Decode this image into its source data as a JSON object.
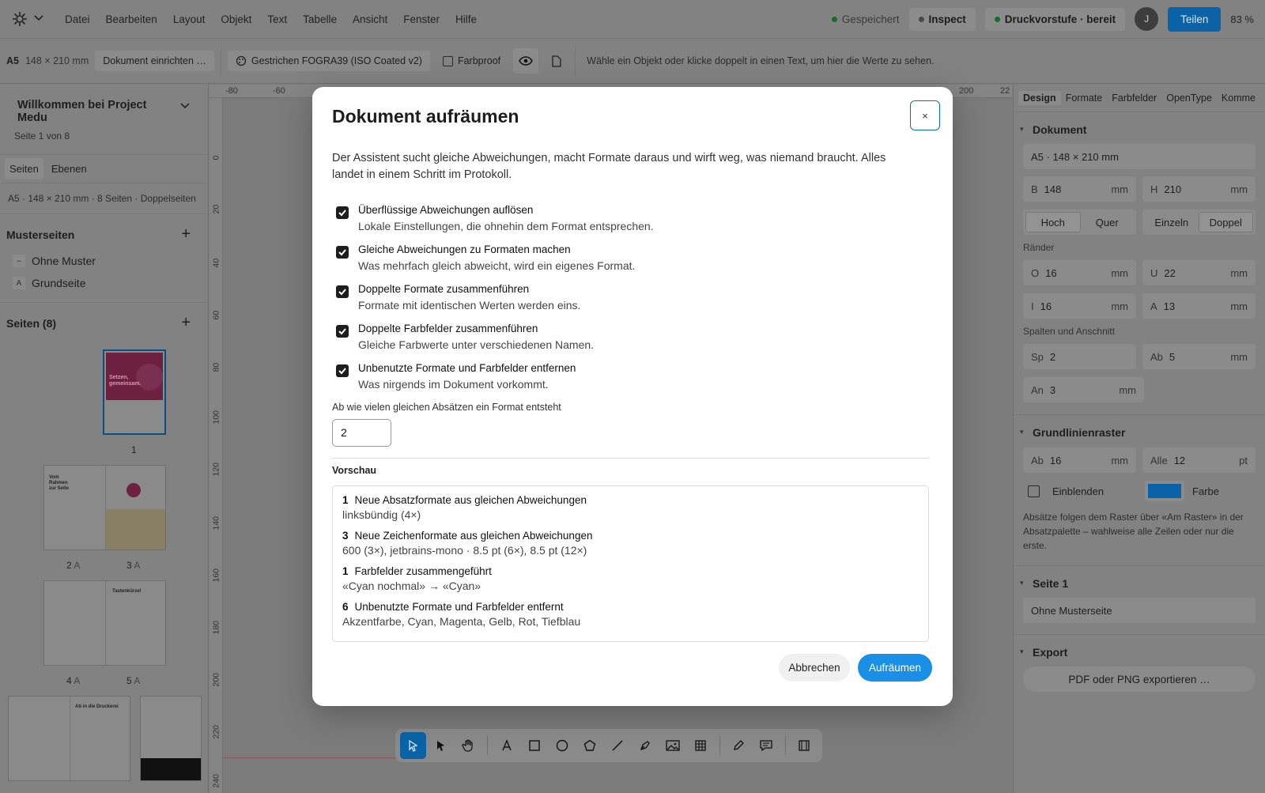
{
  "menu": [
    "Datei",
    "Bearbeiten",
    "Layout",
    "Objekt",
    "Text",
    "Tabelle",
    "Ansicht",
    "Fenster",
    "Hilfe"
  ],
  "status": {
    "saved": "Gespeichert",
    "inspect": "Inspect",
    "preflight": "Druckvorstufe · bereit",
    "avatar": "J",
    "share": "Teilen",
    "zoom": "83 %"
  },
  "toolbar": {
    "format_code": "A5",
    "format_size": "148 × 210 mm",
    "setup": "Dokument einrichten …",
    "profile": "Gestrichen FOGRA39 (ISO Coated v2)",
    "proof": "Farbproof",
    "hint": "Wähle ein Objekt oder klicke doppelt in einen Text, um hier die Werte zu sehen."
  },
  "left": {
    "title": "Willkommen bei Project Medu",
    "sub": "Seite 1 von 8",
    "tabs": [
      "Seiten",
      "Ebenen"
    ],
    "info": "A5 · 148 × 210 mm   ·  8 Seiten  ·  Doppelseiten",
    "masters_title": "Musterseiten",
    "masters": [
      {
        "badge": "–",
        "label": "Ohne Muster"
      },
      {
        "badge": "A",
        "label": "Grundseite"
      }
    ],
    "pages_title": "Seiten (8)",
    "page_labels": [
      "1",
      "2",
      "A",
      "3",
      "A",
      "4",
      "A",
      "5",
      "A"
    ],
    "thumb_text": {
      "cover": "Setzen, gemeinsam.",
      "p2": "Vom Rahmen zur Seite",
      "p5": "Tastenkürzel",
      "p6": "Ab in die Druckerei"
    }
  },
  "ruler_top": [
    "-80",
    "-60",
    "200",
    "22"
  ],
  "ruler_left": [
    "0",
    "20",
    "40",
    "60",
    "80",
    "100",
    "120",
    "140",
    "160",
    "180",
    "200",
    "220",
    "240"
  ],
  "right": {
    "tabs": [
      "Design",
      "Formate",
      "Farbfelder",
      "OpenType",
      "Komme"
    ],
    "doc_title": "Dokument",
    "doc_size": "A5 · 148 × 210 mm",
    "w_label": "B",
    "w": "148",
    "h_label": "H",
    "h": "210",
    "unit": "mm",
    "orient": [
      "Hoch",
      "Quer"
    ],
    "pages": [
      "Einzeln",
      "Doppel"
    ],
    "margins_lbl": "Ränder",
    "m_top_l": "O",
    "m_top": "16",
    "m_bot_l": "U",
    "m_bot": "22",
    "m_in_l": "I",
    "m_in": "16",
    "m_out_l": "A",
    "m_out": "13",
    "cols_lbl": "Spalten und Anschnitt",
    "cols_l": "Sp",
    "cols": "2",
    "gap_l": "Ab",
    "gap": "5",
    "bleed_l": "An",
    "bleed": "3",
    "grid_title": "Grundlinienraster",
    "g_start_l": "Ab",
    "g_start": "16",
    "g_every_l": "Alle",
    "g_every": "12",
    "pt": "pt",
    "g_show": "Einblenden",
    "g_color": "Farbe",
    "g_color_hex": "#0a63a6",
    "grid_note": "Absätze folgen dem Raster über «Am Raster» in der Absatzpalette – wahlweise alle Zeilen oder nur die erste.",
    "page_title": "Seite 1",
    "page_master": "Ohne Musterseite",
    "export_title": "Export",
    "export_btn": "PDF oder PNG exportieren …"
  },
  "modal": {
    "title": "Dokument aufräumen",
    "close": "×",
    "desc": "Der Assistent sucht gleiche Abweichungen, macht Formate daraus und wirft weg, was niemand braucht. Alles landet in einem Schritt im Protokoll.",
    "options": [
      {
        "title": "Überflüssige Abweichungen auflösen",
        "desc": "Lokale Einstellungen, die ohnehin dem Format entsprechen."
      },
      {
        "title": "Gleiche Abweichungen zu Formaten machen",
        "desc": "Was mehrfach gleich abweicht, wird ein eigenes Format."
      },
      {
        "title": "Doppelte Formate zusammenführen",
        "desc": "Formate mit identischen Werten werden eins."
      },
      {
        "title": "Doppelte Farbfelder zusammenführen",
        "desc": "Gleiche Farbwerte unter verschiedenen Namen."
      },
      {
        "title": "Unbenutzte Formate und Farbfelder entfernen",
        "desc": "Was nirgends im Dokument vorkommt."
      }
    ],
    "threshold_label": "Ab wie vielen gleichen Absätzen ein Format entsteht",
    "threshold": "2",
    "preview_label": "Vorschau",
    "preview": [
      {
        "n": "1",
        "title": "Neue Absatzformate aus gleichen Abweichungen",
        "desc": "linksbündig (4×)"
      },
      {
        "n": "3",
        "title": "Neue Zeichenformate aus gleichen Abweichungen",
        "desc": "600 (3×), jetbrains-mono · 8.5 pt (6×), 8.5 pt (12×)"
      },
      {
        "n": "1",
        "title": "Farbfelder zusammengeführt",
        "desc": "«Cyan nochmal» → «Cyan»"
      },
      {
        "n": "6",
        "title": "Unbenutzte Formate und Farbfelder entfernt",
        "desc": "Akzentfarbe, Cyan, Magenta, Gelb, Rot, Tiefblau"
      }
    ],
    "cancel": "Abbrechen",
    "confirm": "Aufräumen"
  }
}
